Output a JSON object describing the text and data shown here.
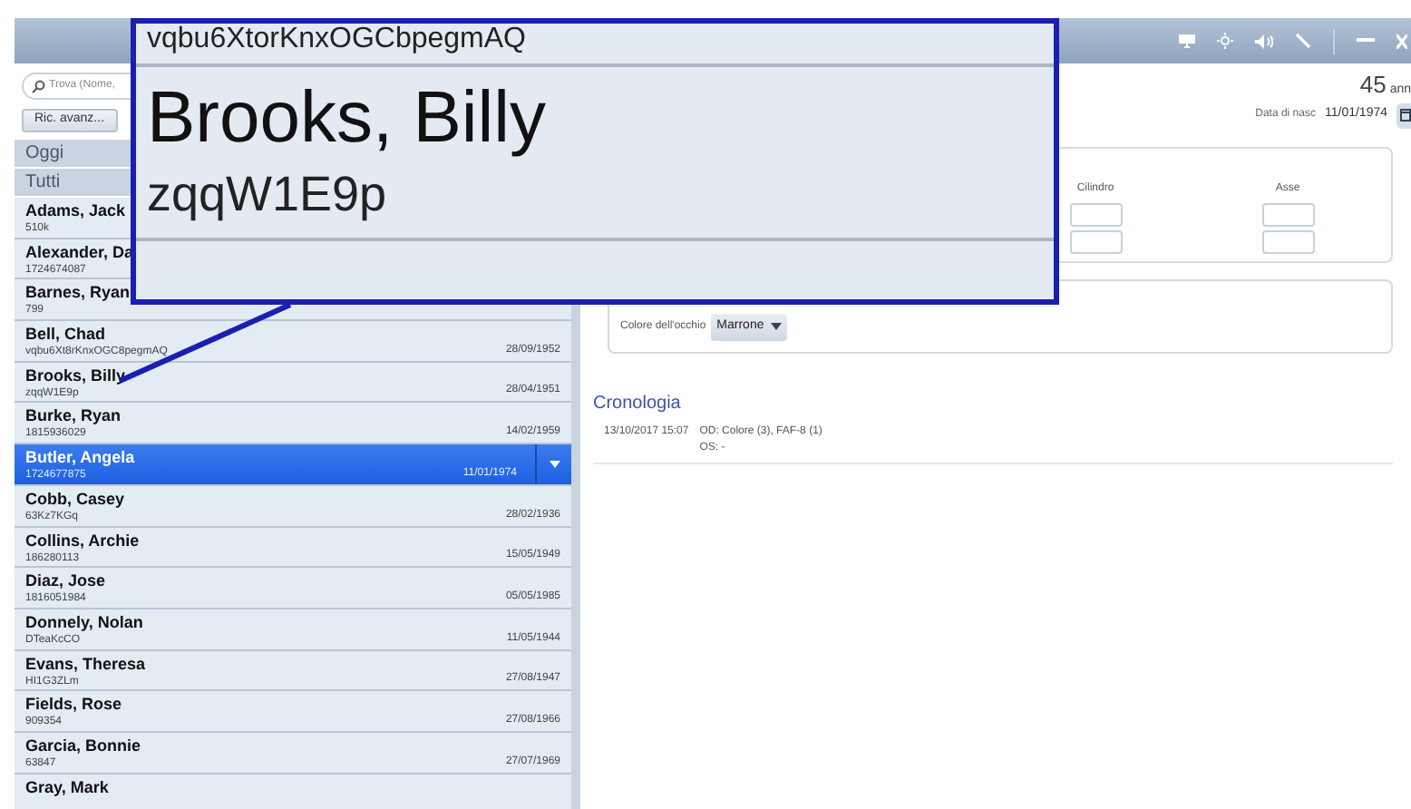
{
  "sidebar": {
    "search": {
      "placeholder": "Trova (Nome,"
    },
    "advanced_button": "Ric. avanz...",
    "groups": [
      {
        "label": "Oggi"
      },
      {
        "label": "Tutti"
      }
    ],
    "patients": [
      {
        "name": "Adams, Jack",
        "id": "510k",
        "selected": false
      },
      {
        "name": "Alexander, Da",
        "id": "1724674087",
        "selected": false
      },
      {
        "name": "Barnes, Ryan",
        "id": "799",
        "selected": false
      },
      {
        "name": "Bell, Chad",
        "id": "vqbu6Xt8rKnxOGC8pegmAQ",
        "birth": "28/09/1952",
        "selected": false
      },
      {
        "name": "Brooks, Billy",
        "id": "zqqW1E9p",
        "birth": "28/04/1951",
        "selected": false
      },
      {
        "name": "Burke, Ryan",
        "id": "1815936029",
        "birth": "14/02/1959",
        "selected": false
      },
      {
        "name": "Butler, Angela",
        "id": "1724677875",
        "birth": "11/01/1974",
        "selected": true
      },
      {
        "name": "Cobb, Casey",
        "id": "63Kz7KGq",
        "birth": "28/02/1936",
        "selected": false
      },
      {
        "name": "Collins, Archie",
        "id": "186280113",
        "birth": "15/05/1949",
        "selected": false
      },
      {
        "name": "Diaz, Jose",
        "id": "1816051984",
        "birth": "05/05/1985",
        "selected": false
      },
      {
        "name": "Donnely, Nolan",
        "id": "DTeaKcCO",
        "birth": "11/05/1944",
        "selected": false
      },
      {
        "name": "Evans, Theresa",
        "id": "HI1G3ZLm",
        "birth": "27/08/1947",
        "selected": false
      },
      {
        "name": "Fields, Rose",
        "id": "909354",
        "birth": "27/08/1966",
        "selected": false
      },
      {
        "name": "Garcia, Bonnie",
        "id": "63847",
        "birth": "27/07/1969",
        "selected": false
      },
      {
        "name": "Gray, Mark",
        "selected": false
      }
    ]
  },
  "patient": {
    "age": "45",
    "age_unit": "ann",
    "birth_label": "Data di nasc",
    "birth": "11/01/1974"
  },
  "refraction": {
    "columns": [
      "Cilindro",
      "Asse"
    ]
  },
  "eye": {
    "label": "Colore dell'occhio",
    "value": "Marrone"
  },
  "history": {
    "title": "Cronologia",
    "entries": [
      {
        "time": "13/10/2017 15:07",
        "od": "OD: Colore (3), FAF-8 (1)",
        "os": "OS: -"
      }
    ]
  },
  "magnifier": {
    "top_line": "vqbu6XtorKnxOGCbpegmAQ",
    "name": "Brooks, Billy",
    "id": "zqqW1E9p"
  }
}
